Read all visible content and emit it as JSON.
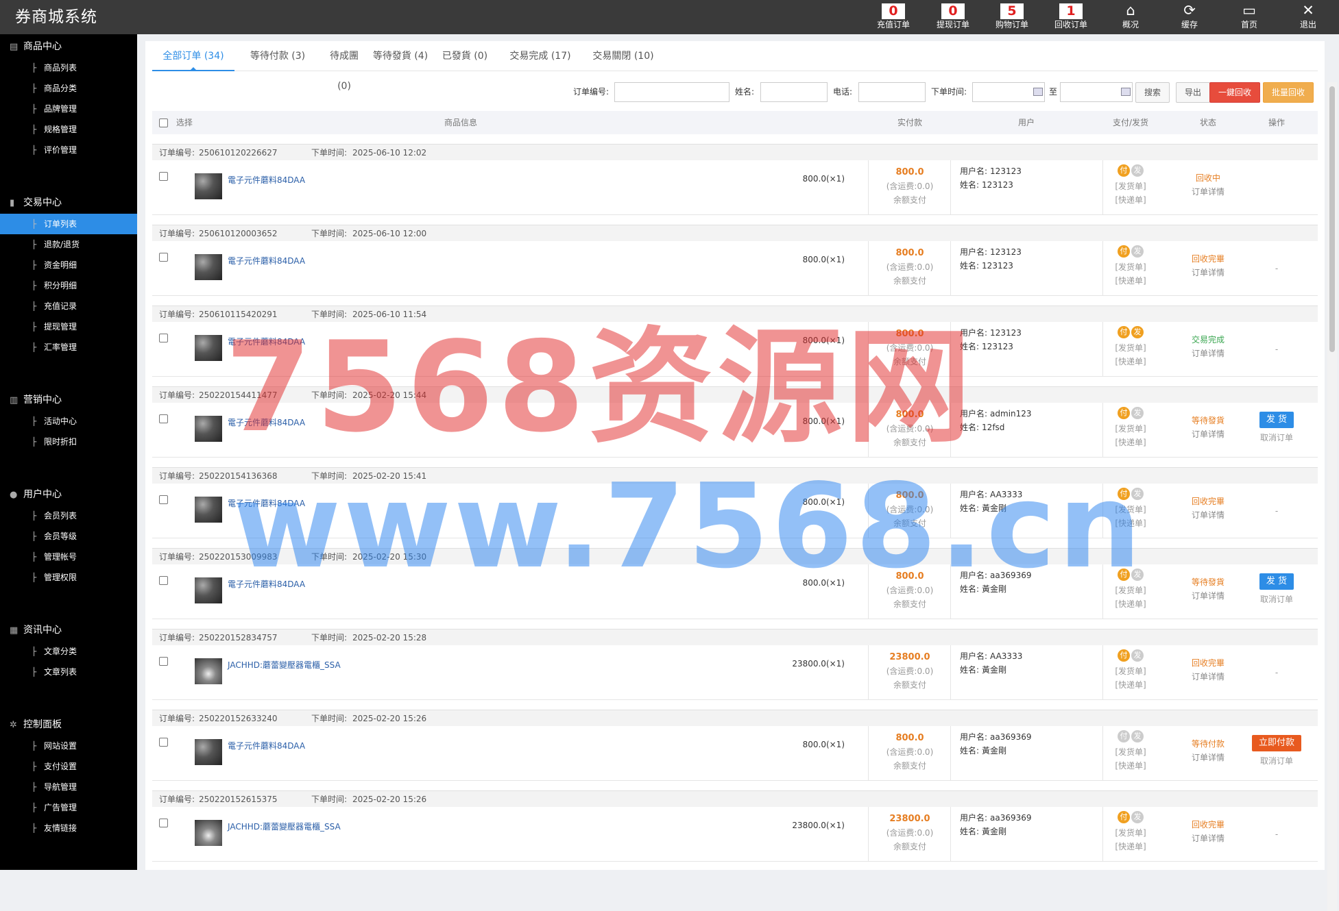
{
  "app": {
    "title": "券商城系统"
  },
  "topnav": [
    {
      "label": "充值订单",
      "badge": "0",
      "icon": "recharge-order"
    },
    {
      "label": "提现订单",
      "badge": "0",
      "icon": "withdraw-order"
    },
    {
      "label": "购物订单",
      "badge": "5",
      "icon": "shopping-order"
    },
    {
      "label": "回收订单",
      "badge": "1",
      "icon": "recycle-order"
    },
    {
      "label": "概况",
      "icon": "home-icon",
      "glyph": "⌂"
    },
    {
      "label": "缓存",
      "icon": "refresh-icon",
      "glyph": "⟳"
    },
    {
      "label": "首页",
      "icon": "monitor-icon",
      "glyph": "▭"
    },
    {
      "label": "退出",
      "icon": "close-icon",
      "glyph": "✕"
    }
  ],
  "sidebar": {
    "groups": [
      {
        "label": "商品中心",
        "icon": "store-icon",
        "glyph": "▤",
        "items": [
          "商品列表",
          "商品分类",
          "品牌管理",
          "规格管理",
          "评价管理"
        ]
      },
      {
        "label": "交易中心",
        "icon": "bar-chart-icon",
        "glyph": "▮",
        "items": [
          "订单列表",
          "退款/退货",
          "资金明细",
          "积分明细",
          "充值记录",
          "提现管理",
          "汇率管理"
        ]
      },
      {
        "label": "营销中心",
        "icon": "marketing-icon",
        "glyph": "▥",
        "items": [
          "活动中心",
          "限时折扣"
        ]
      },
      {
        "label": "用户中心",
        "icon": "user-icon",
        "glyph": "●",
        "items": [
          "会员列表",
          "会员等级",
          "管理帐号",
          "管理权限"
        ]
      },
      {
        "label": "资讯中心",
        "icon": "news-icon",
        "glyph": "▦",
        "items": [
          "文章分类",
          "文章列表"
        ]
      },
      {
        "label": "控制面板",
        "icon": "gear-icon",
        "glyph": "✲",
        "items": [
          "网站设置",
          "支付设置",
          "导航管理",
          "广告管理",
          "友情链接"
        ]
      }
    ],
    "active_item": "订单列表"
  },
  "tabs": [
    "全部订单 (34)",
    "等待付款 (3)",
    "待成團 (0)",
    "等待發貨 (4)",
    "已發貨 (0)",
    "交易完成 (17)",
    "交易關閉 (10)"
  ],
  "search": {
    "order_no_label": "订单编号:",
    "name_label": "姓名:",
    "phone_label": "电话:",
    "time_label": "下单时间:",
    "to_label": "至",
    "search_btn": "搜索",
    "export_btn": "导出",
    "recycle_btn": "一鍵回收",
    "batch_recycle_btn": "批量回收"
  },
  "table": {
    "headers": {
      "select": "选择",
      "product": "商品信息",
      "paid": "实付款",
      "user": "用户",
      "pay_ship": "支付/发货",
      "status": "状态",
      "action": "操作"
    },
    "order_no_prefix": "订单编号:",
    "order_time_prefix": "下单时间:",
    "shipping_prefix": "(含运费:",
    "balance_pay": "余额支付",
    "user_prefix": "用户名:",
    "realname_prefix": "姓名:",
    "ship_link": "[发货单]",
    "express_link": "[快递单]",
    "detail_link": "订单详情",
    "pay_glyph": "付",
    "ship_glyph": "发"
  },
  "orders": [
    {
      "no": "250610120226627",
      "time": "2025-06-10 12:02",
      "product": "電子元件蘑料84DAA",
      "price": "800.0(×1)",
      "amount": "800.0",
      "shipping": "0.0)",
      "username": "123123",
      "realname": "123123",
      "status": "回收中",
      "status_color": "#e67e22",
      "pay_on": true,
      "ship_on": false,
      "action": "",
      "thumb": "a"
    },
    {
      "no": "250610120003652",
      "time": "2025-06-10 12:00",
      "product": "電子元件蘑料84DAA",
      "price": "800.0(×1)",
      "amount": "800.0",
      "shipping": "0.0)",
      "username": "123123",
      "realname": "123123",
      "status": "回收完畢",
      "status_color": "#e67e22",
      "pay_on": true,
      "ship_on": false,
      "action": "-",
      "thumb": "a"
    },
    {
      "no": "250610115420291",
      "time": "2025-06-10 11:54",
      "product": "電子元件蘑料84DAA",
      "price": "800.0(×1)",
      "amount": "800.0",
      "shipping": "0.0)",
      "username": "123123",
      "realname": "123123",
      "status": "交易完成",
      "status_color": "#3aa650",
      "pay_on": true,
      "ship_on": true,
      "action": "-",
      "thumb": "a"
    },
    {
      "no": "250220154411477",
      "time": "2025-02-20 15:44",
      "product": "電子元件蘑料84DAA",
      "price": "800.0(×1)",
      "amount": "800.0",
      "shipping": "0.0)",
      "username": "admin123",
      "realname": "12fsd",
      "status": "等待發貨",
      "status_color": "#e67e22",
      "pay_on": true,
      "ship_on": false,
      "action": "发 货",
      "action_type": "blue",
      "cancel": "取消订单",
      "thumb": "a"
    },
    {
      "no": "250220154136368",
      "time": "2025-02-20 15:41",
      "product": "電子元件蘑料84DAA",
      "price": "800.0(×1)",
      "amount": "800.0",
      "shipping": "0.0)",
      "username": "AA3333",
      "realname": "黃金剛",
      "status": "回收完畢",
      "status_color": "#e67e22",
      "pay_on": true,
      "ship_on": false,
      "action": "-",
      "thumb": "a"
    },
    {
      "no": "250220153009983",
      "time": "2025-02-20 15:30",
      "product": "電子元件蘑料84DAA",
      "price": "800.0(×1)",
      "amount": "800.0",
      "shipping": "0.0)",
      "username": "aa369369",
      "realname": "黃金剛",
      "status": "等待發貨",
      "status_color": "#e67e22",
      "pay_on": true,
      "ship_on": false,
      "action": "发 货",
      "action_type": "blue",
      "cancel": "取消订单",
      "thumb": "a"
    },
    {
      "no": "250220152834757",
      "time": "2025-02-20 15:28",
      "product": "JACHHD:蘑蕾變壓器電櫃_SSA",
      "price": "23800.0(×1)",
      "amount": "23800.0",
      "shipping": "0.0)",
      "username": "AA3333",
      "realname": "黃金剛",
      "status": "回收完畢",
      "status_color": "#e67e22",
      "pay_on": true,
      "ship_on": false,
      "action": "-",
      "thumb": "b"
    },
    {
      "no": "250220152633240",
      "time": "2025-02-20 15:26",
      "product": "電子元件蘑料84DAA",
      "price": "800.0(×1)",
      "amount": "800.0",
      "shipping": "0.0)",
      "username": "aa369369",
      "realname": "黃金剛",
      "status": "等待付款",
      "status_color": "#e67e22",
      "pay_on": false,
      "ship_on": false,
      "action": "立即付款",
      "action_type": "red",
      "cancel": "取消订单",
      "thumb": "a"
    },
    {
      "no": "250220152615375",
      "time": "2025-02-20 15:26",
      "product": "JACHHD:蘑蕾變壓器電櫃_SSA",
      "price": "23800.0(×1)",
      "amount": "23800.0",
      "shipping": "0.0)",
      "username": "aa369369",
      "realname": "黃金剛",
      "status": "回收完畢",
      "status_color": "#e67e22",
      "pay_on": true,
      "ship_on": false,
      "action": "-",
      "thumb": "b"
    }
  ],
  "watermark": {
    "line1": "7568资源网",
    "line2": "www.7568.cn"
  }
}
